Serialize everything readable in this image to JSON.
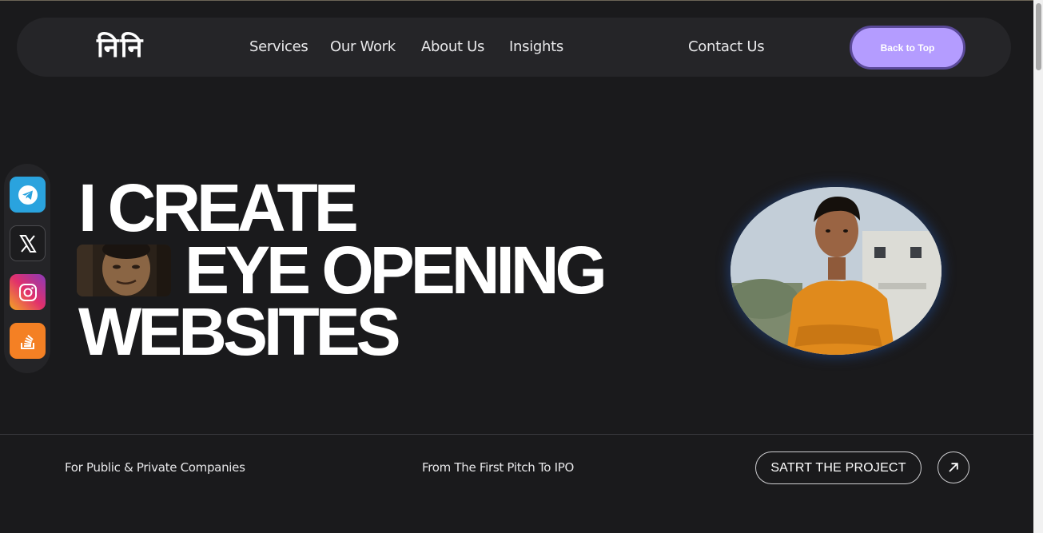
{
  "nav": {
    "logo": "निनि",
    "links": [
      "Services",
      "Our Work",
      "About Us",
      "Insights",
      "Contact Us"
    ],
    "back_to_top": "Back to Top"
  },
  "social": [
    {
      "icon": "telegram-icon",
      "color": "#2aa3de"
    },
    {
      "icon": "x-icon",
      "color": "#1c1c1e"
    },
    {
      "icon": "instagram-icon",
      "color": "#e1306c"
    },
    {
      "icon": "stackoverflow-icon",
      "color": "#f48024"
    }
  ],
  "hero": {
    "line1": "I CREATE",
    "line2": "EYE OPENING",
    "line3": "WEBSITES"
  },
  "footer": {
    "left": "For Public & Private Companies",
    "middle": "From The First Pitch To IPO",
    "cta": "SATRT THE PROJECT"
  },
  "colors": {
    "background": "#1a1a1c",
    "accent": "#b49cff"
  }
}
